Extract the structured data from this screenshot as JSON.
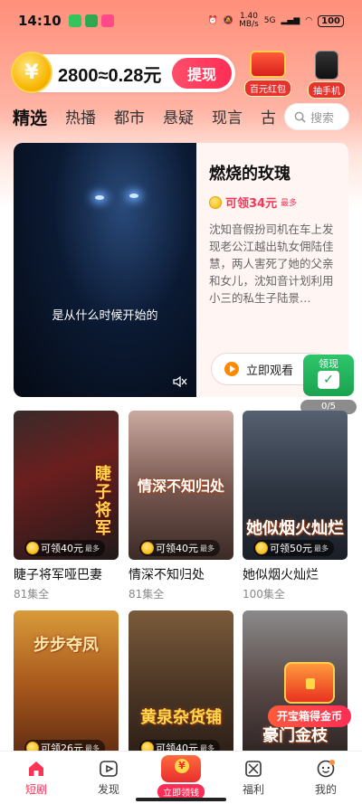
{
  "status_bar": {
    "time": "14:10",
    "net_speed": "1.40",
    "net_unit": "MB/s",
    "signal": "5G",
    "battery": "100"
  },
  "header": {
    "coin_symbol": "¥",
    "exchange_text": "2800≈0.28元",
    "withdraw_label": "提现",
    "promo_redpacket": "百元红包",
    "promo_phone": "抽手机"
  },
  "tabs": [
    "精选",
    "热播",
    "都市",
    "悬疑",
    "现言",
    "古"
  ],
  "search_placeholder": "搜索",
  "featured": {
    "title": "燃烧的玫瑰",
    "reward": "可领34元",
    "reward_suffix": "最多",
    "description": "沈知音假扮司机在车上发现老公江越出轨女佣陆佳慧，两人害死了她的父亲和女儿，沈知音计划利用小三的私生子陆景…",
    "subtitle": "是从什么时候开始的",
    "watch_label": "立即观看"
  },
  "float_widget": {
    "label": "领现",
    "progress": "0/5"
  },
  "dramas": [
    {
      "name": "睫子将军哑巴妻",
      "poster_title": "睫子将军",
      "reward": "可领40元",
      "max": "最多",
      "eps": "81集全"
    },
    {
      "name": "情深不知归处",
      "poster_title": "情深不知归处",
      "reward": "可领40元",
      "max": "最多",
      "eps": "81集全"
    },
    {
      "name": "她似烟火灿烂",
      "poster_title": "她似烟火灿烂",
      "reward": "可领50元",
      "max": "最多",
      "eps": "100集全"
    },
    {
      "poster_title": "步步夺凤",
      "reward": "可领26元",
      "max": "最多"
    },
    {
      "poster_title": "黄泉杂货铺",
      "reward": "可领40元",
      "max": "最多"
    },
    {
      "poster_title": "豪门金枝",
      "reward": "",
      "max": ""
    }
  ],
  "treasure_label": "开宝箱得金币",
  "bottom_nav": [
    {
      "label": "短剧",
      "icon": "home-icon"
    },
    {
      "label": "发现",
      "icon": "play-icon"
    },
    {
      "label": "立即领钱",
      "icon": "money-bag-icon"
    },
    {
      "label": "福利",
      "icon": "gift-icon"
    },
    {
      "label": "我的",
      "icon": "profile-icon"
    }
  ],
  "colors": {
    "accent": "#ff3355",
    "coin": "#f7b500",
    "green": "#1aa350"
  }
}
